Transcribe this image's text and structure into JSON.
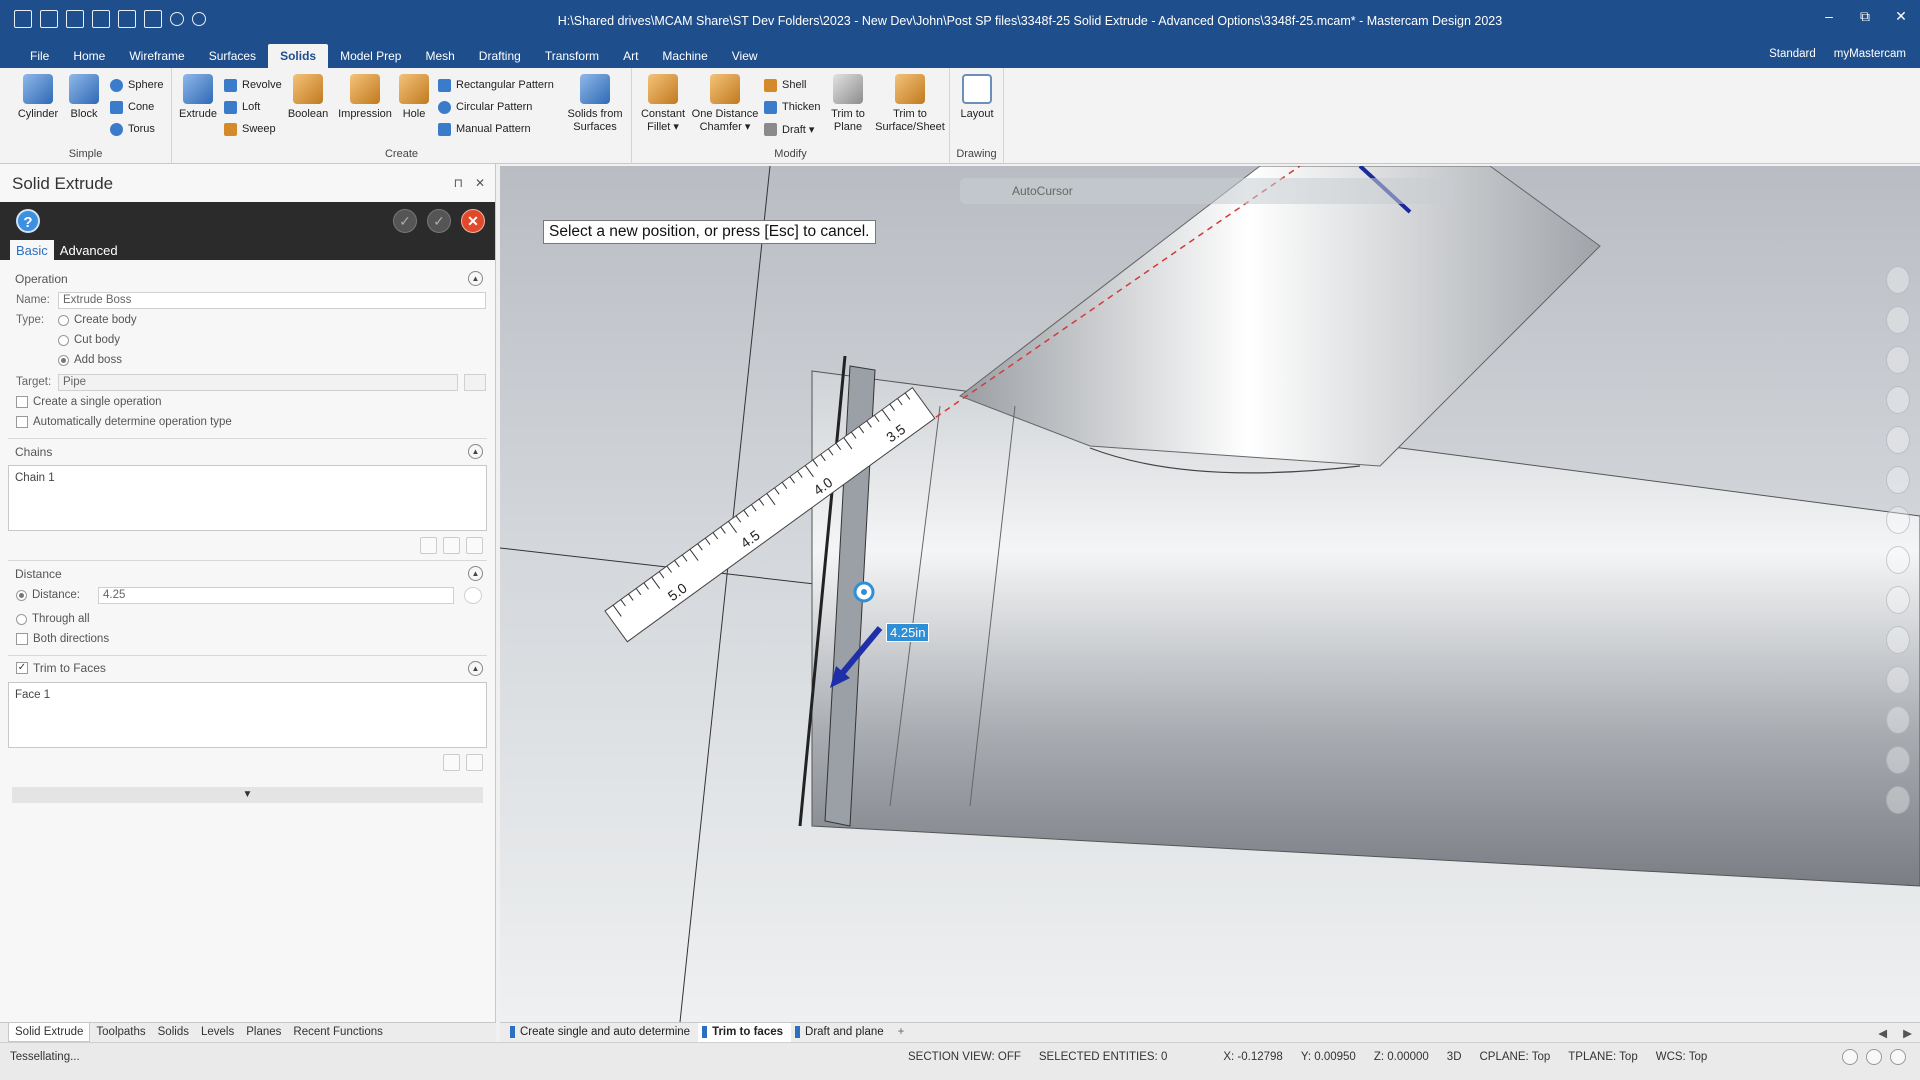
{
  "window": {
    "title": "H:\\Shared drives\\MCAM Share\\ST Dev Folders\\2023 - New Dev\\John\\Post SP files\\3348f-25 Solid Extrude - Advanced Options\\3348f-25.mcam* - Mastercam Design 2023",
    "min_glyph": "–",
    "max_glyph": "⧉",
    "close_glyph": "✕"
  },
  "menu": {
    "tabs": [
      "File",
      "Home",
      "Wireframe",
      "Surfaces",
      "Solids",
      "Model Prep",
      "Mesh",
      "Drafting",
      "Transform",
      "Art",
      "Machine",
      "View"
    ],
    "active": "Solids",
    "right": {
      "standard": "Standard",
      "mymastercam": "myMastercam"
    }
  },
  "ribbon": {
    "groups": {
      "simple": "Simple",
      "create": "Create",
      "modify": "Modify",
      "drawing": "Drawing"
    },
    "simple": {
      "cylinder": "Cylinder",
      "block": "Block",
      "sphere": "Sphere",
      "cone": "Cone",
      "torus": "Torus"
    },
    "create": {
      "extrude": "Extrude",
      "revolve": "Revolve",
      "loft": "Loft",
      "sweep": "Sweep",
      "boolean": "Boolean",
      "impression": "Impression",
      "hole": "Hole",
      "rect_pattern": "Rectangular Pattern",
      "circ_pattern": "Circular Pattern",
      "manual_pattern": "Manual Pattern",
      "solids_from_surfaces_1": "Solids from",
      "solids_from_surfaces_2": "Surfaces"
    },
    "modify": {
      "constant_fillet_1": "Constant",
      "constant_fillet_2": "Fillet ▾",
      "one_distance_1": "One Distance",
      "one_distance_2": "Chamfer ▾",
      "shell": "Shell",
      "thicken": "Thicken",
      "draft": "Draft ▾",
      "trim_plane_1": "Trim to",
      "trim_plane_2": "Plane",
      "trim_surface_1": "Trim to",
      "trim_surface_2": "Surface/Sheet"
    },
    "drawing": {
      "layout": "Layout"
    }
  },
  "panel": {
    "title": "Solid Extrude",
    "pin_glyph": "⊓",
    "close_glyph": "✕",
    "help_glyph": "?",
    "ok_glyph": "✓",
    "tabs": {
      "basic": "Basic",
      "advanced": "Advanced"
    },
    "operation": {
      "header": "Operation",
      "name_label": "Name:",
      "name_value": "Extrude Boss",
      "type_label": "Type:",
      "type_options": [
        "Create body",
        "Cut body",
        "Add boss"
      ],
      "type_selected": "Add boss",
      "target_label": "Target:",
      "target_value": "Pipe",
      "single_op": "Create a single operation",
      "auto_type": "Automatically determine operation type"
    },
    "chains": {
      "header": "Chains",
      "items": [
        "Chain  1"
      ]
    },
    "distance": {
      "header": "Distance",
      "distance_label": "Distance:",
      "distance_value": "4.25",
      "through_all": "Through all",
      "both_directions": "Both directions"
    },
    "trim": {
      "header": "Trim to Faces",
      "checked": true,
      "items": [
        "Face 1"
      ]
    },
    "collapse_glyph": "▲",
    "expand_glyph": "▼"
  },
  "viewport": {
    "autocursor": "AutoCursor",
    "prompt": "Select a new position, or press [Esc] to cancel.",
    "dimension": "4.25in",
    "ruler_ticks": [
      "3.5",
      "4.0",
      "4.5",
      "5.0"
    ]
  },
  "bottom_tabs": {
    "left": [
      "Solid Extrude",
      "Toolpaths",
      "Solids",
      "Levels",
      "Planes",
      "Recent Functions"
    ],
    "left_active": "Solid Extrude",
    "views": [
      "Create single and auto determine",
      "Trim to faces",
      "Draft and plane"
    ],
    "views_active": "Trim to faces",
    "add_glyph": "+",
    "nav_prev": "◀",
    "nav_next": "▶"
  },
  "status": {
    "left": "Tessellating...",
    "section_view": "SECTION VIEW: OFF",
    "selected": "SELECTED ENTITIES: 0",
    "x": "X:  -0.12798",
    "y": "Y:  0.00950",
    "z": "Z:  0.00000",
    "mode": "3D",
    "cplane": "CPLANE: Top",
    "tplane": "TPLANE: Top",
    "wcs": "WCS: Top"
  },
  "colors": {
    "title_bar": "#1f4e8c",
    "accent": "#2a6fc0",
    "dimension": "#2f8fd6",
    "close": "#e04a2a"
  }
}
